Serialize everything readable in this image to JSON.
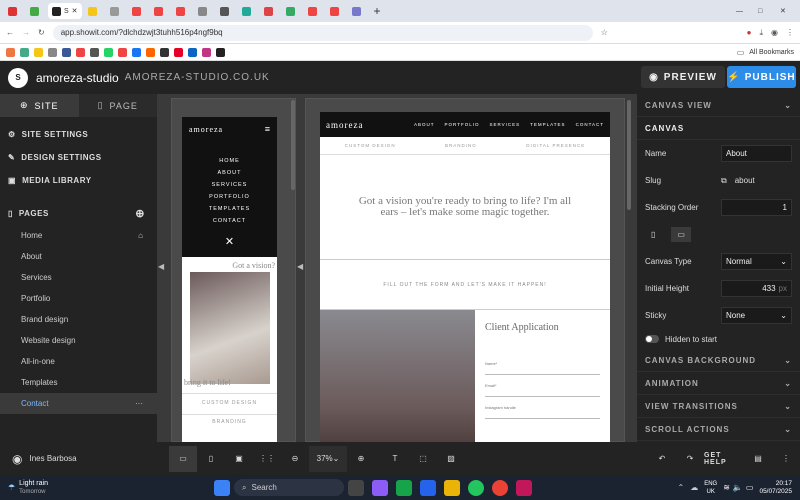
{
  "browser": {
    "active_tab": "S",
    "url": "app.showit.com/?dlchdzwjt3tuhh516p4ngf9bq",
    "bookmarks_label": "All Bookmarks"
  },
  "app": {
    "site_name": "amoreza-studio",
    "domain": "AMOREZA-STUDIO.CO.UK",
    "preview_label": "PREVIEW",
    "publish_label": "PUBLISH"
  },
  "sidebar": {
    "tab_site": "SITE",
    "tab_page": "PAGE",
    "site_settings": "SITE SETTINGS",
    "design_settings": "DESIGN SETTINGS",
    "media_library": "MEDIA LIBRARY",
    "pages_label": "PAGES",
    "pages": [
      "Home",
      "About",
      "Services",
      "Portfolio",
      "Brand design",
      "Website design",
      "All-in-one",
      "Templates",
      "Contact"
    ],
    "selected_page": "Contact",
    "user": "Ines Barbosa"
  },
  "mobile_preview": {
    "brand": "amoreza",
    "menu": [
      "HOME",
      "ABOUT",
      "SERVICES",
      "PORTFOLIO",
      "TEMPLATES",
      "CONTACT"
    ],
    "tagline": "Got a vision?",
    "bring": "bring it to life!",
    "custom_design": "CUSTOM DESIGN",
    "branding": "BRANDING"
  },
  "desktop_preview": {
    "brand": "amoreza",
    "nav": [
      "ABOUT",
      "PORTFOLIO",
      "SERVICES",
      "TEMPLATES",
      "CONTACT"
    ],
    "services": [
      "CUSTOM DESIGN",
      "BRANDING",
      "DIGITAL PRESENCE"
    ],
    "headline": "Got a vision you're ready to bring to life? I'm all ears – let's make some magic together.",
    "cta": "FILL OUT THE FORM AND LET'S MAKE IT HAPPEN!",
    "form_title": "Client Application",
    "fields": [
      "Name*",
      "Email*",
      "Instagram handle"
    ]
  },
  "right_panel": {
    "canvas_view": "CANVAS VIEW",
    "canvas": "CANVAS",
    "name_label": "Name",
    "name_value": "About",
    "slug_label": "Slug",
    "slug_value": "about",
    "stacking_label": "Stacking Order",
    "stacking_value": "1",
    "canvas_type_label": "Canvas Type",
    "canvas_type_value": "Normal",
    "initial_height_label": "Initial Height",
    "initial_height_value": "433",
    "initial_height_unit": "px",
    "sticky_label": "Sticky",
    "sticky_value": "None",
    "hidden_label": "Hidden to start",
    "sections": [
      "CANVAS BACKGROUND",
      "ANIMATION",
      "VIEW TRANSITIONS",
      "SCROLL ACTIONS"
    ]
  },
  "toolbar": {
    "zoom": "37%",
    "get_help": "GET HELP"
  },
  "taskbar": {
    "weather": "Light rain",
    "weather_sub": "Tomorrow",
    "search": "Search",
    "lang": "ENG",
    "region": "UK",
    "time": "20:17",
    "date": "05/07/2025"
  }
}
